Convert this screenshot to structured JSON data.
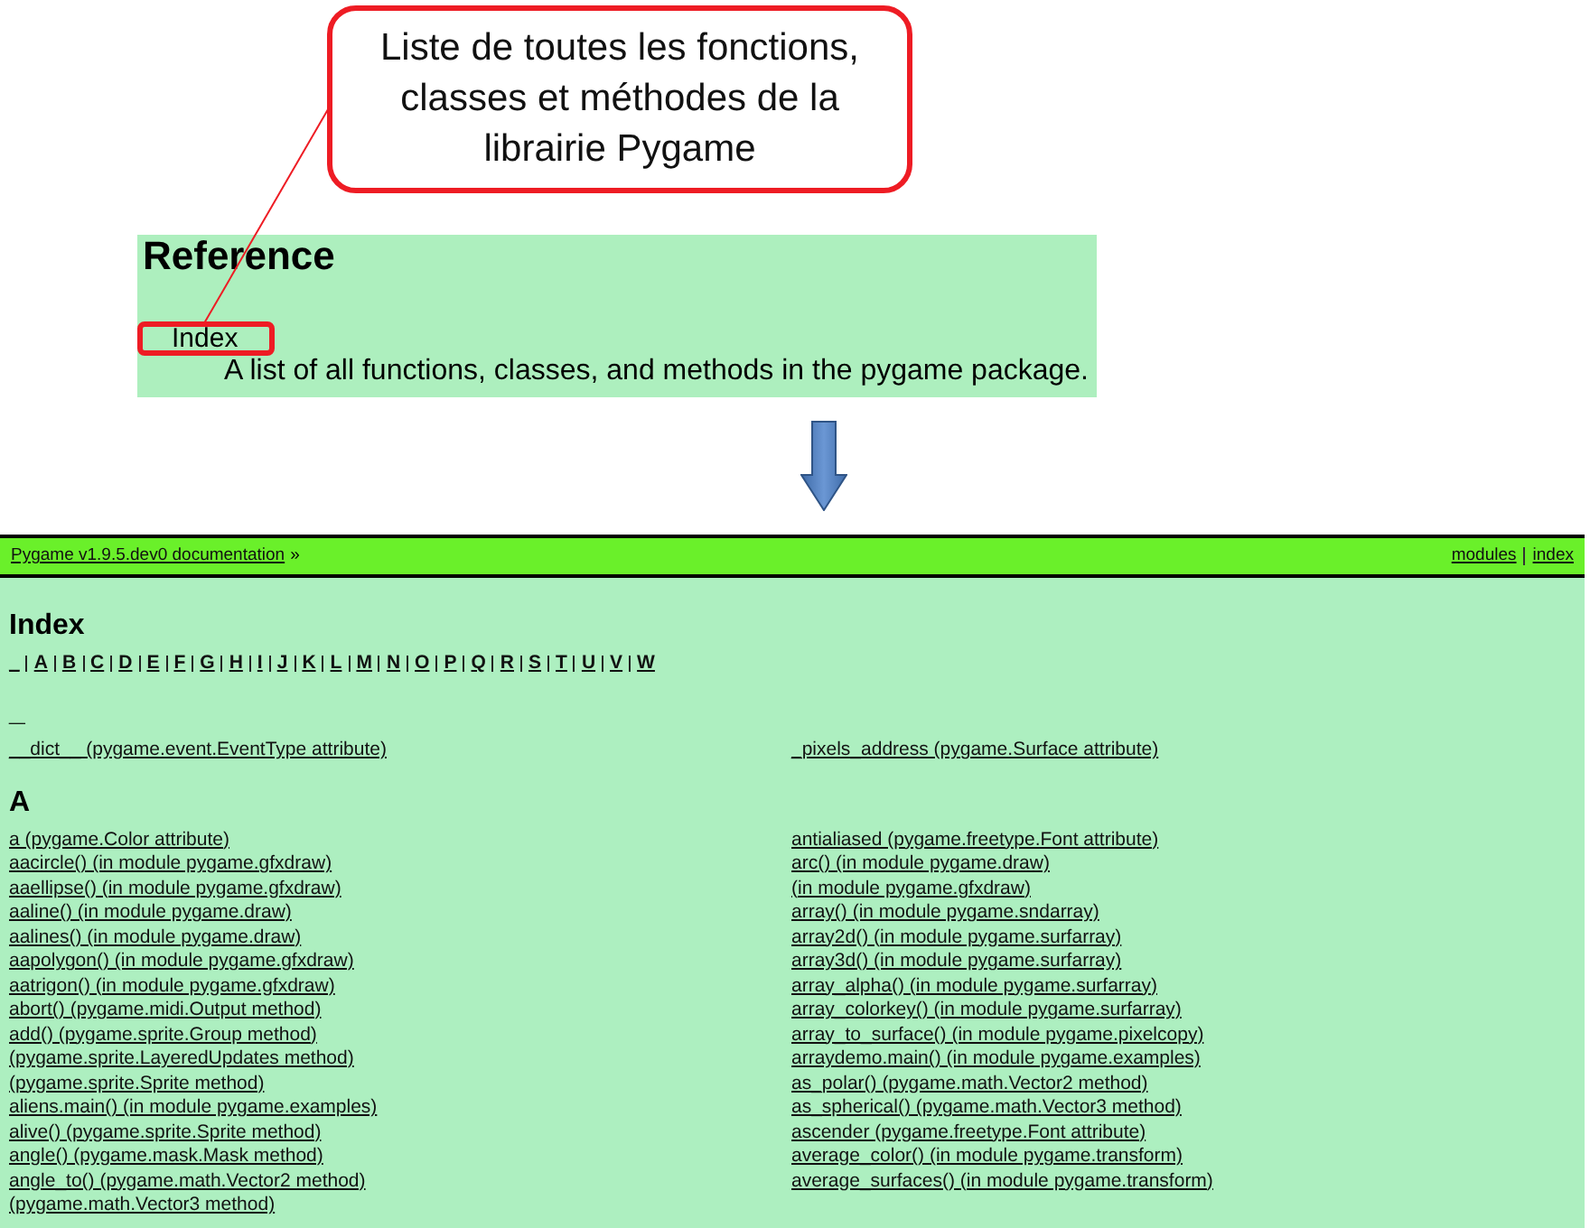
{
  "callout": {
    "text": "Liste de toutes les fonctions,\nclasses et méthodes de la\nlibrairie Pygame"
  },
  "reference": {
    "title": "Reference",
    "link": "Index",
    "highlighted": true,
    "description": "A list of all functions, classes, and methods in the pygame package."
  },
  "docs_page": {
    "breadcrumb": {
      "link": "Pygame v1.9.5.dev0 documentation",
      "suffix": "»"
    },
    "nav_links": [
      "modules",
      "index"
    ],
    "title": "Index",
    "letters": [
      "_",
      "A",
      "B",
      "C",
      "D",
      "E",
      "F",
      "G",
      "H",
      "I",
      "J",
      "K",
      "L",
      "M",
      "N",
      "O",
      "P",
      "Q",
      "R",
      "S",
      "T",
      "U",
      "V",
      "W"
    ],
    "sections": [
      {
        "heading": "_",
        "left": [
          "__dict__ (pygame.event.EventType attribute)"
        ],
        "right": [
          "_pixels_address (pygame.Surface attribute)"
        ]
      },
      {
        "heading": "A",
        "left": [
          "a (pygame.Color attribute)",
          "aacircle() (in module pygame.gfxdraw)",
          "aaellipse() (in module pygame.gfxdraw)",
          "aaline() (in module pygame.draw)",
          "aalines() (in module pygame.draw)",
          "aapolygon() (in module pygame.gfxdraw)",
          "aatrigon() (in module pygame.gfxdraw)",
          "abort() (pygame.midi.Output method)",
          "add() (pygame.sprite.Group method)",
          "(pygame.sprite.LayeredUpdates method)",
          "(pygame.sprite.Sprite method)",
          "aliens.main() (in module pygame.examples)",
          "alive() (pygame.sprite.Sprite method)",
          "angle() (pygame.mask.Mask method)",
          "angle_to() (pygame.math.Vector2 method)",
          "(pygame.math.Vector3 method)"
        ],
        "right": [
          "antialiased (pygame.freetype.Font attribute)",
          "arc() (in module pygame.draw)",
          "(in module pygame.gfxdraw)",
          "array() (in module pygame.sndarray)",
          "array2d() (in module pygame.surfarray)",
          "array3d() (in module pygame.surfarray)",
          "array_alpha() (in module pygame.surfarray)",
          "array_colorkey() (in module pygame.surfarray)",
          "array_to_surface() (in module pygame.pixelcopy)",
          "arraydemo.main() (in module pygame.examples)",
          "as_polar() (pygame.math.Vector2 method)",
          "as_spherical() (pygame.math.Vector3 method)",
          "ascender (pygame.freetype.Font attribute)",
          "average_color() (in module pygame.transform)",
          "average_surfaces() (in module pygame.transform)"
        ]
      }
    ]
  }
}
